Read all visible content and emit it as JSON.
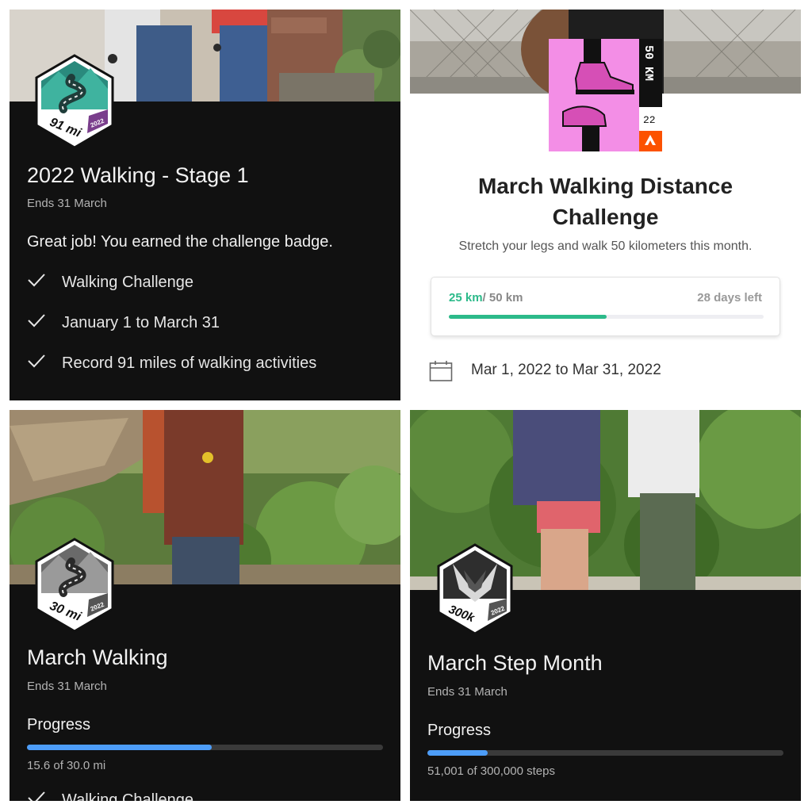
{
  "panels": {
    "walking_stage1": {
      "badge": {
        "distance": "91 mi",
        "year": "2022"
      },
      "title": "2022 Walking - Stage 1",
      "ends": "Ends 31 March",
      "earned": "Great job! You earned the challenge badge.",
      "checks": [
        "Walking Challenge",
        "January 1 to March 31",
        "Record 91 miles of walking activities"
      ]
    },
    "strava": {
      "badge": {
        "distance": "50 KM",
        "year": "22"
      },
      "title_line1": "March Walking Distance",
      "title_line2": "Challenge",
      "description": "Stretch your legs and walk 50 kilometers this month.",
      "progress_current": "25 km",
      "progress_total": "/ 50 km",
      "progress_fraction": 0.5,
      "days_left": "28 days left",
      "date_range": "Mar 1, 2022 to Mar 31, 2022"
    },
    "march_walking": {
      "badge": {
        "distance": "30 mi",
        "year": "2022"
      },
      "title": "March Walking",
      "ends": "Ends 31 March",
      "progress_label": "Progress",
      "progress_fraction": 0.52,
      "progress_text": "15.6 of 30.0 mi",
      "check_partial": "Walking Challenge"
    },
    "march_steps": {
      "badge": {
        "distance": "300k",
        "year": "2022"
      },
      "title": "March Step Month",
      "ends": "Ends 31 March",
      "progress_label": "Progress",
      "progress_fraction": 0.17,
      "progress_text": "51,001 of 300,000 steps"
    }
  },
  "colors": {
    "dark_bg": "#111111",
    "blue_progress": "#4d9df8",
    "strava_green": "#2cba8a",
    "strava_orange": "#fc5200",
    "strava_pink": "#f38ee6"
  }
}
